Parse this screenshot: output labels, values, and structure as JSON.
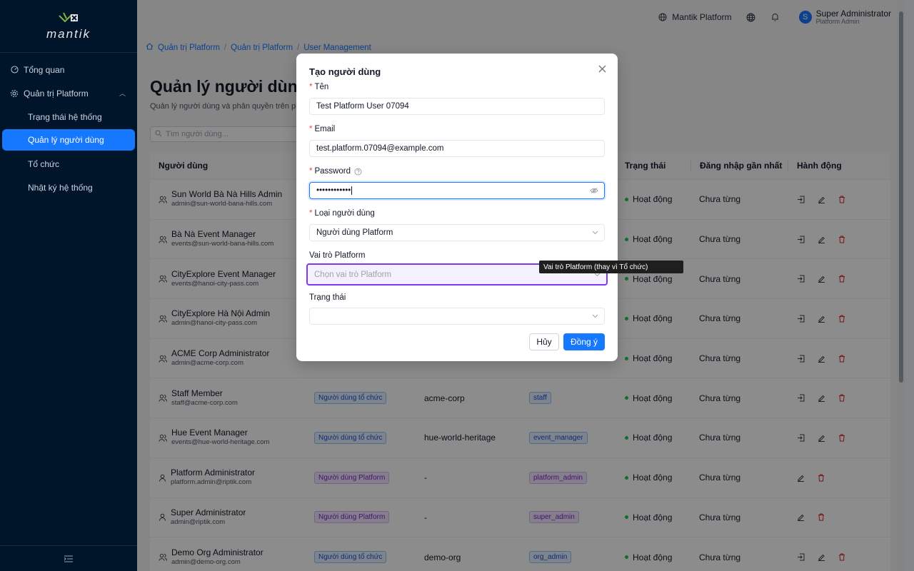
{
  "brand": {
    "name": "mantik"
  },
  "sidebar": {
    "items": [
      {
        "label": "Tổng quan"
      },
      {
        "label": "Quản trị Platform"
      }
    ],
    "sub_items": [
      {
        "label": "Trạng thái hệ thống"
      },
      {
        "label": "Quản lý người dùng"
      },
      {
        "label": "Tổ chức"
      },
      {
        "label": "Nhật ký hệ thống"
      }
    ]
  },
  "topbar": {
    "platform_label": "Mantik Platform",
    "user_name": "Super Administrator",
    "user_role": "Platform Admin",
    "avatar_letter": "S"
  },
  "breadcrumb": [
    "Quản trị Platform",
    "Quản trị Platform",
    "User Management"
  ],
  "page": {
    "title": "Quản lý người dùng",
    "subtitle": "Quản lý người dùng và phân quyền trên plat",
    "search_placeholder": "Tìm người dùng..."
  },
  "table": {
    "headers": {
      "user": "Người dùng",
      "status": "Trạng thái",
      "last_login": "Đăng nhập gần nhất",
      "actions": "Hành động"
    },
    "rows": [
      {
        "name": "Sun World Bà Nà Hills Admin",
        "email": "admin@sun-world-bana-hills.com",
        "type": "",
        "org": "",
        "role": "",
        "status": "Hoạt động",
        "last": "Chưa từng"
      },
      {
        "name": "Bà Nà Event Manager",
        "email": "events@sun-world-bana-hills.com",
        "type": "",
        "org": "",
        "role": "",
        "status": "Hoạt động",
        "last": "Chưa từng"
      },
      {
        "name": "CityExplore Event Manager",
        "email": "events@hanoi-city-pass.com",
        "type": "",
        "org": "",
        "role": "",
        "status": "Hoạt động",
        "last": "Chưa từng"
      },
      {
        "name": "CityExplore Hà Nội Admin",
        "email": "admin@hanoi-city-pass.com",
        "type": "",
        "org": "",
        "role": "",
        "status": "Hoạt động",
        "last": "Chưa từng"
      },
      {
        "name": "ACME Corp Administrator",
        "email": "admin@acme-corp.com",
        "type": "",
        "org": "",
        "role": "",
        "status": "Hoạt động",
        "last": "Chưa từng"
      },
      {
        "name": "Staff Member",
        "email": "staff@acme-corp.com",
        "type": "Người dùng tổ chức",
        "org": "acme-corp",
        "role": "staff",
        "status": "Hoạt động",
        "last": "Chưa từng"
      },
      {
        "name": "Hue Event Manager",
        "email": "events@hue-world-heritage.com",
        "type": "Người dùng tổ chức",
        "org": "hue-world-heritage",
        "role": "event_manager",
        "status": "Hoạt động",
        "last": "Chưa từng"
      },
      {
        "name": "Platform Administrator",
        "email": "platform.admin@riptik.com",
        "type": "Người dùng Platform",
        "org": "-",
        "role": "platform_admin",
        "status": "Hoạt động",
        "last": "Chưa từng"
      },
      {
        "name": "Super Administrator",
        "email": "admin@riptik.com",
        "type": "Người dùng Platform",
        "org": "-",
        "role": "super_admin",
        "status": "Hoạt động",
        "last": "Chưa từng"
      },
      {
        "name": "Demo Org Administrator",
        "email": "admin@demo-org.com",
        "type": "Người dùng tổ chức",
        "org": "demo-org",
        "role": "org_admin",
        "status": "Hoạt động",
        "last": "Chưa từng"
      }
    ]
  },
  "modal": {
    "title": "Tạo người dùng",
    "name_label": "Tên",
    "name_value": "Test Platform User 07094",
    "email_label": "Email",
    "email_value": "test.platform.07094@example.com",
    "password_label": "Password",
    "password_value": "••••••••••••",
    "user_type_label": "Loại người dùng",
    "user_type_value": "Người dùng Platform",
    "platform_role_label": "Vai trò Platform",
    "platform_role_placeholder": "Chọn vai trò Platform",
    "status_label": "Trạng thái",
    "status_value": "",
    "cancel_label": "Hủy",
    "ok_label": "Đồng ý",
    "tooltip": "Vai trò Platform (thay vì Tổ chức)"
  }
}
